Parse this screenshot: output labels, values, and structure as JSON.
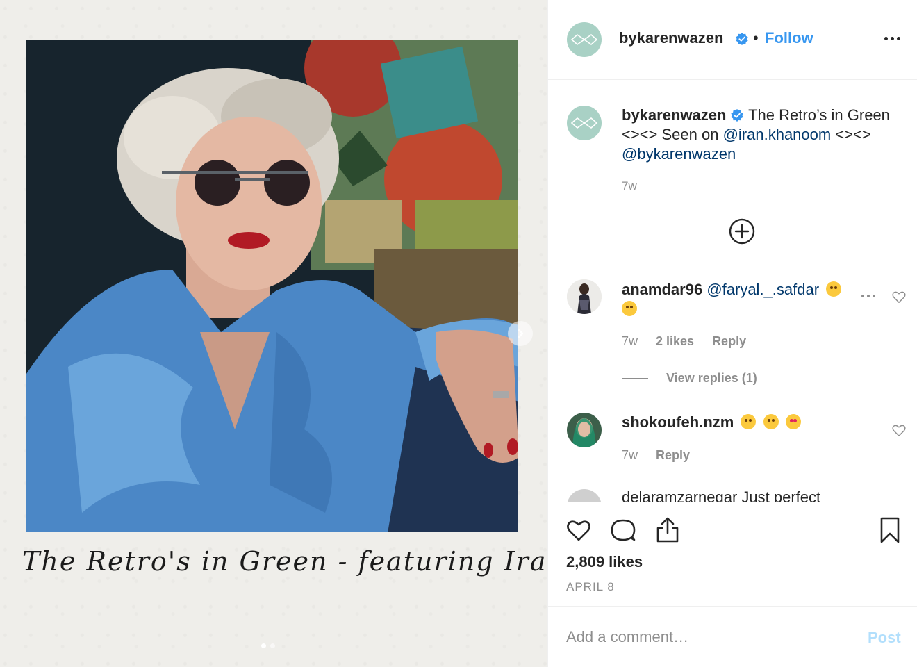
{
  "post": {
    "photo_caption": "The Retro's in Green - featuring Iran",
    "carousel": {
      "count": 2,
      "active": 1
    }
  },
  "header": {
    "username": "bykarenwazen",
    "separator": "•",
    "follow_label": "Follow"
  },
  "caption": {
    "username": "bykarenwazen",
    "text_part1": " The Retro’s in Green <><> Seen on ",
    "mention1": "@iran.khanoom",
    "text_part2": " <><> ",
    "mention2": "@bykarenwazen",
    "time": "7w"
  },
  "comments": [
    {
      "username": "anamdar96",
      "mention": "@faryal._.safdar",
      "time": "7w",
      "likes": "2 likes",
      "reply": "Reply",
      "view_replies": "View replies (1)"
    },
    {
      "username": "shokoufeh.nzm",
      "time": "7w",
      "reply": "Reply"
    },
    {
      "partial_text": "delaramzarnegar Just perfect"
    }
  ],
  "actions": {
    "likes": "2,809 likes",
    "date": "APRIL 8"
  },
  "add_comment": {
    "placeholder": "Add a comment…",
    "post_label": "Post"
  },
  "colors": {
    "accent": "#3897f0",
    "mention": "#00376b",
    "muted": "#8e8e8e",
    "avatar_bg": "#a9d1c5",
    "post_disabled": "#b2dffc"
  },
  "icons": [
    "verified-badge-icon",
    "more-icon",
    "add-circle-icon",
    "heart-icon",
    "comment-icon",
    "share-icon",
    "bookmark-icon",
    "chevron-right-icon"
  ]
}
